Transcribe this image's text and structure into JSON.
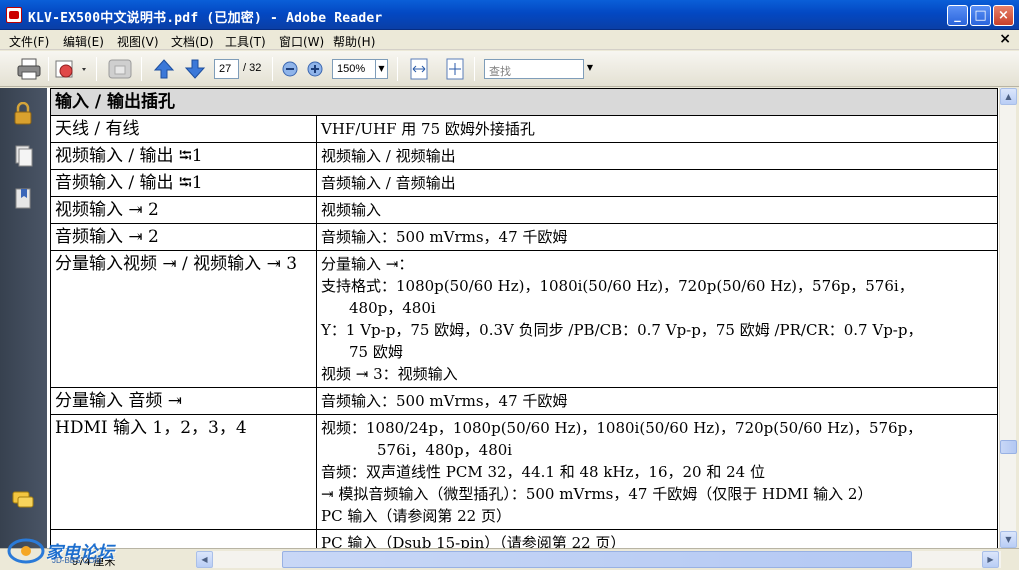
{
  "window": {
    "title": "KLV-EX500中文说明书.pdf  (已加密)  - Adobe Reader",
    "min_symbol": "_",
    "max_symbol": "□",
    "close_symbol": "×"
  },
  "menubar": {
    "items": [
      "文件(F)",
      "编辑(E)",
      "视图(V)",
      "文档(D)",
      "工具(T)",
      "窗口(W)",
      "帮助(H)"
    ],
    "close_doc": "×"
  },
  "toolbar": {
    "page_current": "27",
    "page_total": "/ 32",
    "zoom_value": "150%",
    "search_placeholder": "查找",
    "icons": [
      "print-icon",
      "email-icon",
      "hand-tool-icon",
      "prev-page-icon",
      "next-page-icon",
      "zoom-out-icon",
      "zoom-in-icon",
      "fit-width-icon",
      "fit-page-icon"
    ]
  },
  "navpane": {
    "icons": [
      "lock-icon",
      "pages-icon",
      "bookmarks-icon",
      "comments-icon"
    ]
  },
  "table": {
    "header": "输入 / 输出插孔",
    "rows": [
      {
        "left": "天线 / 有线",
        "right": [
          "VHF/UHF 用 75 欧姆外接插孔"
        ]
      },
      {
        "left": "视频输入 / 输出 ⭾1",
        "right": [
          "视频输入 / 视频输出"
        ]
      },
      {
        "left": "音频输入 / 输出 ⭾1",
        "right": [
          "音频输入 / 音频输出"
        ]
      },
      {
        "left": "视频输入 ⇥ 2",
        "right": [
          "视频输入"
        ]
      },
      {
        "left": "音频输入 ⇥ 2",
        "right": [
          "音频输入：500 mVrms，47 千欧姆"
        ]
      },
      {
        "left": "分量输入视频 ⇥ / 视频输入 ⇥ 3",
        "right": [
          "分量输入 ⇥：",
          "支持格式：1080p(50/60 Hz)，1080i(50/60 Hz)，720p(50/60 Hz)，576p，576i，",
          "480p，480i",
          "Y：1 Vp-p，75 欧姆，0.3V 负同步 /PB/CB：0.7 Vp-p，75 欧姆 /PR/CR：0.7 Vp-p，",
          "75 欧姆",
          "视频 ⇥ 3：视频输入"
        ]
      },
      {
        "left": "分量输入 音频 ⇥",
        "right": [
          "音频输入：500 mVrms，47 千欧姆"
        ]
      },
      {
        "left": "HDMI 输入 1，2，3，4",
        "right": [
          "视频：1080/24p，1080p(50/60 Hz)，1080i(50/60 Hz)，720p(50/60 Hz)，576p，",
          "576i，480p，480i",
          "音频：双声道线性 PCM 32，44.1 和 48 kHz，16，20 和 24 位",
          "⇥ 模拟音频输入（微型插孔）：500 mVrms，47 千欧姆（仅限于 HDMI 输入 2）",
          "PC 输入（请参阅第 22 页）"
        ]
      },
      {
        "left": "",
        "right": [
          "PC 输入（Dsub 15-pin）（请参阅第 22 页）"
        ]
      }
    ]
  },
  "status": {
    "page_size": "974 厘米",
    "watermark_text": "家电论坛",
    "watermark_sub": "JD-BBS.COM"
  }
}
